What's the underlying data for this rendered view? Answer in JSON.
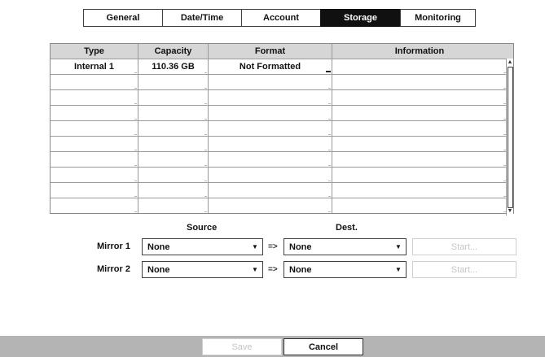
{
  "tabs": [
    {
      "label": "General",
      "active": false
    },
    {
      "label": "Date/Time",
      "active": false
    },
    {
      "label": "Account",
      "active": false
    },
    {
      "label": "Storage",
      "active": true
    },
    {
      "label": "Monitoring",
      "active": false
    }
  ],
  "storage_table": {
    "columns": [
      "Type",
      "Capacity",
      "Format",
      "Information"
    ],
    "rows": [
      [
        "Internal 1",
        "110.36 GB",
        "Not Formatted",
        ""
      ],
      [
        "",
        "",
        "",
        ""
      ],
      [
        "",
        "",
        "",
        ""
      ],
      [
        "",
        "",
        "",
        ""
      ],
      [
        "",
        "",
        "",
        ""
      ],
      [
        "",
        "",
        "",
        ""
      ],
      [
        "",
        "",
        "",
        ""
      ],
      [
        "",
        "",
        "",
        ""
      ],
      [
        "",
        "",
        "",
        ""
      ],
      [
        "",
        "",
        "",
        ""
      ]
    ]
  },
  "mirror": {
    "source_header": "Source",
    "dest_header": "Dest.",
    "arrow": "=>",
    "rows": [
      {
        "label": "Mirror 1",
        "source": "None",
        "dest": "None",
        "start_label": "Start..."
      },
      {
        "label": "Mirror 2",
        "source": "None",
        "dest": "None",
        "start_label": "Start..."
      }
    ]
  },
  "footer": {
    "save_label": "Save",
    "cancel_label": "Cancel"
  },
  "icons": {
    "dropdown": "chevron-down-icon",
    "scroll_up": "arrow-up-icon",
    "scroll_down": "arrow-down-icon"
  },
  "colors": {
    "active_tab_bg": "#101010",
    "header_bg": "#d6d6d6",
    "footer_bg": "#b4b4b4",
    "disabled_text": "#c4c4c4"
  }
}
